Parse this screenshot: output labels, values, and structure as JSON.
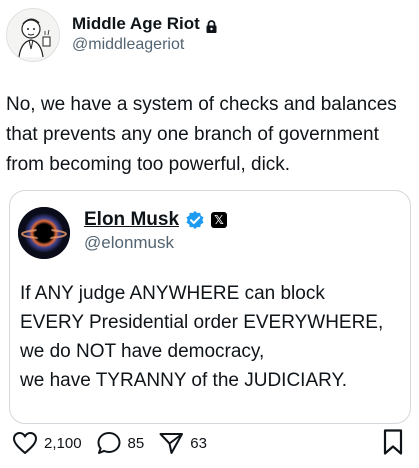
{
  "post": {
    "author": {
      "display_name": "Middle Age Riot",
      "handle": "@middleageriot",
      "protected_icon": "lock-icon"
    },
    "text": "No, we have a system of checks and balances that prevents any one branch of government from becoming too powerful, dick."
  },
  "quote": {
    "author": {
      "display_name": "Elon Musk",
      "handle": "@elonmusk",
      "verified_icon": "verified-badge-icon",
      "affiliation_icon": "x-logo-icon",
      "affiliation_glyph": "𝕏"
    },
    "lines": [
      "If ANY judge ANYWHERE can block",
      "EVERY Presidential order EVERYWHERE,",
      "we do NOT have democracy,",
      "we have TYRANNY of the JUDICIARY."
    ]
  },
  "actions": {
    "like_count": "2,100",
    "reply_count": "85",
    "share_count": "63",
    "icons": [
      "heart-icon",
      "reply-icon",
      "share-icon",
      "bookmark-icon"
    ]
  },
  "colors": {
    "text": "#0f1419",
    "secondary": "#536471",
    "verified": "#1d9bf0",
    "border": "#d4d9dd"
  }
}
